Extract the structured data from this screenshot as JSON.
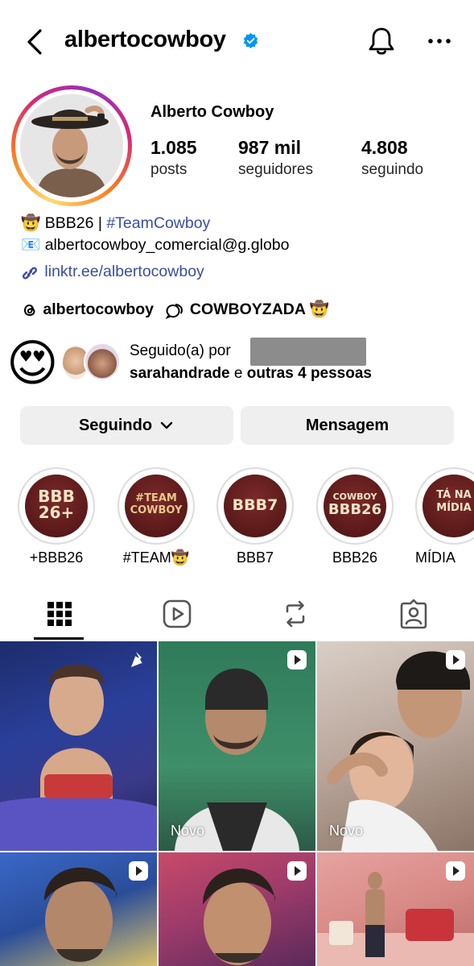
{
  "header": {
    "username": "albertocowboy",
    "icons": [
      "back-arrow-icon",
      "verified-badge-icon",
      "bell-icon",
      "more-icon"
    ]
  },
  "profile": {
    "display_name": "Alberto Cowboy",
    "stats": [
      {
        "value": "1.085",
        "label": "posts"
      },
      {
        "value": "987 mil",
        "label": "seguidores"
      },
      {
        "value": "4.808",
        "label": "seguindo"
      }
    ]
  },
  "bio": {
    "line1_emoji": "🤠",
    "line1_text": "BBB26 | ",
    "line1_hashtag": "#TeamCowboy",
    "line2_emoji": "📧",
    "line2_text": "albertocowboy_comercial@g.globo",
    "link": "linktr.ee/albertocowboy",
    "threads_handle": "albertocowboy",
    "channel_name": "COWBOYZADA",
    "channel_emoji": "🤠"
  },
  "followed_by": {
    "emoji": "😍",
    "prefix": "Seguido(a) por",
    "name": "sarahandrade",
    "connector": " e ",
    "others": "outras 4 pessoas"
  },
  "buttons": {
    "following": "Seguindo",
    "message": "Mensagem"
  },
  "highlights": [
    {
      "label": "+BBB26",
      "art": "BBB\n26+"
    },
    {
      "label": "#TEAM🤠",
      "art": "#TEAM\nCOWBOY"
    },
    {
      "label": "BBB7",
      "art": "BBB7"
    },
    {
      "label": "BBB26",
      "art": "COWBOY\nBBB26"
    },
    {
      "label": "MÍDIA",
      "art": "TÁ NA\nMÍDIA"
    }
  ],
  "tabs": [
    "grid-icon",
    "reels-icon",
    "reposts-icon",
    "tagged-icon"
  ],
  "grid": [
    {
      "badge": "pin-icon",
      "caption": ""
    },
    {
      "badge": "reel-icon",
      "caption": "Novo"
    },
    {
      "badge": "reel-icon",
      "caption": "Novo"
    },
    {
      "badge": "reel-icon",
      "caption": ""
    },
    {
      "badge": "reel-icon",
      "caption": ""
    },
    {
      "badge": "reel-icon",
      "caption": ""
    }
  ],
  "colors": {
    "link": "#3a4ca8",
    "verified": "#0095f6",
    "button_bg": "#efefef",
    "redacted": "#8c8c8c"
  }
}
